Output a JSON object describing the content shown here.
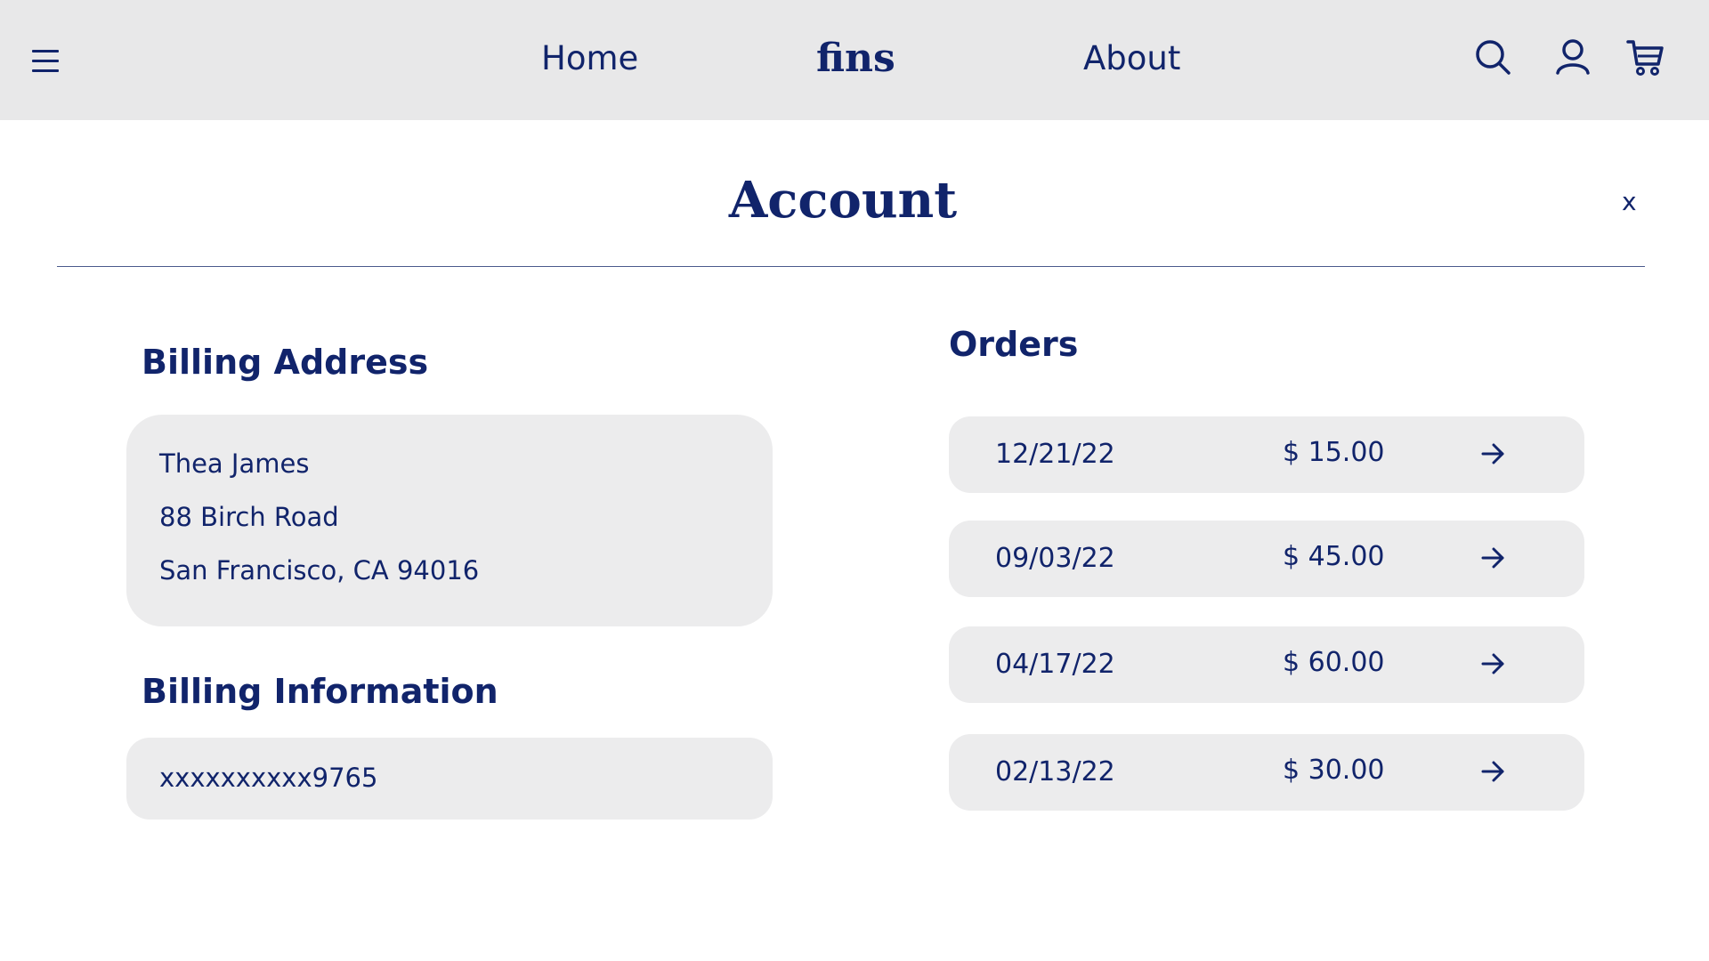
{
  "colors": {
    "brand": "#11246b",
    "header_bg": "#e8e8e9",
    "card_bg": "#ececed"
  },
  "header": {
    "menu_icon": "hamburger-menu-icon",
    "nav": {
      "home": "Home",
      "about": "About"
    },
    "logo": "fins",
    "icons": [
      "search-icon",
      "user-icon",
      "cart-icon"
    ]
  },
  "page": {
    "title": "Account",
    "close": "x"
  },
  "billing_address": {
    "heading": "Billing Address",
    "lines": [
      "Thea James",
      "88 Birch Road",
      "San Francisco, CA 94016"
    ]
  },
  "billing_information": {
    "heading": "Billing Information",
    "card_number": "xxxxxxxxxx9765"
  },
  "orders": {
    "heading": "Orders",
    "items": [
      {
        "date": "12/21/22",
        "amount": "$ 15.00"
      },
      {
        "date": "09/03/22",
        "amount": "$ 45.00"
      },
      {
        "date": "04/17/22",
        "amount": "$ 60.00"
      },
      {
        "date": "02/13/22",
        "amount": "$ 30.00"
      }
    ]
  }
}
